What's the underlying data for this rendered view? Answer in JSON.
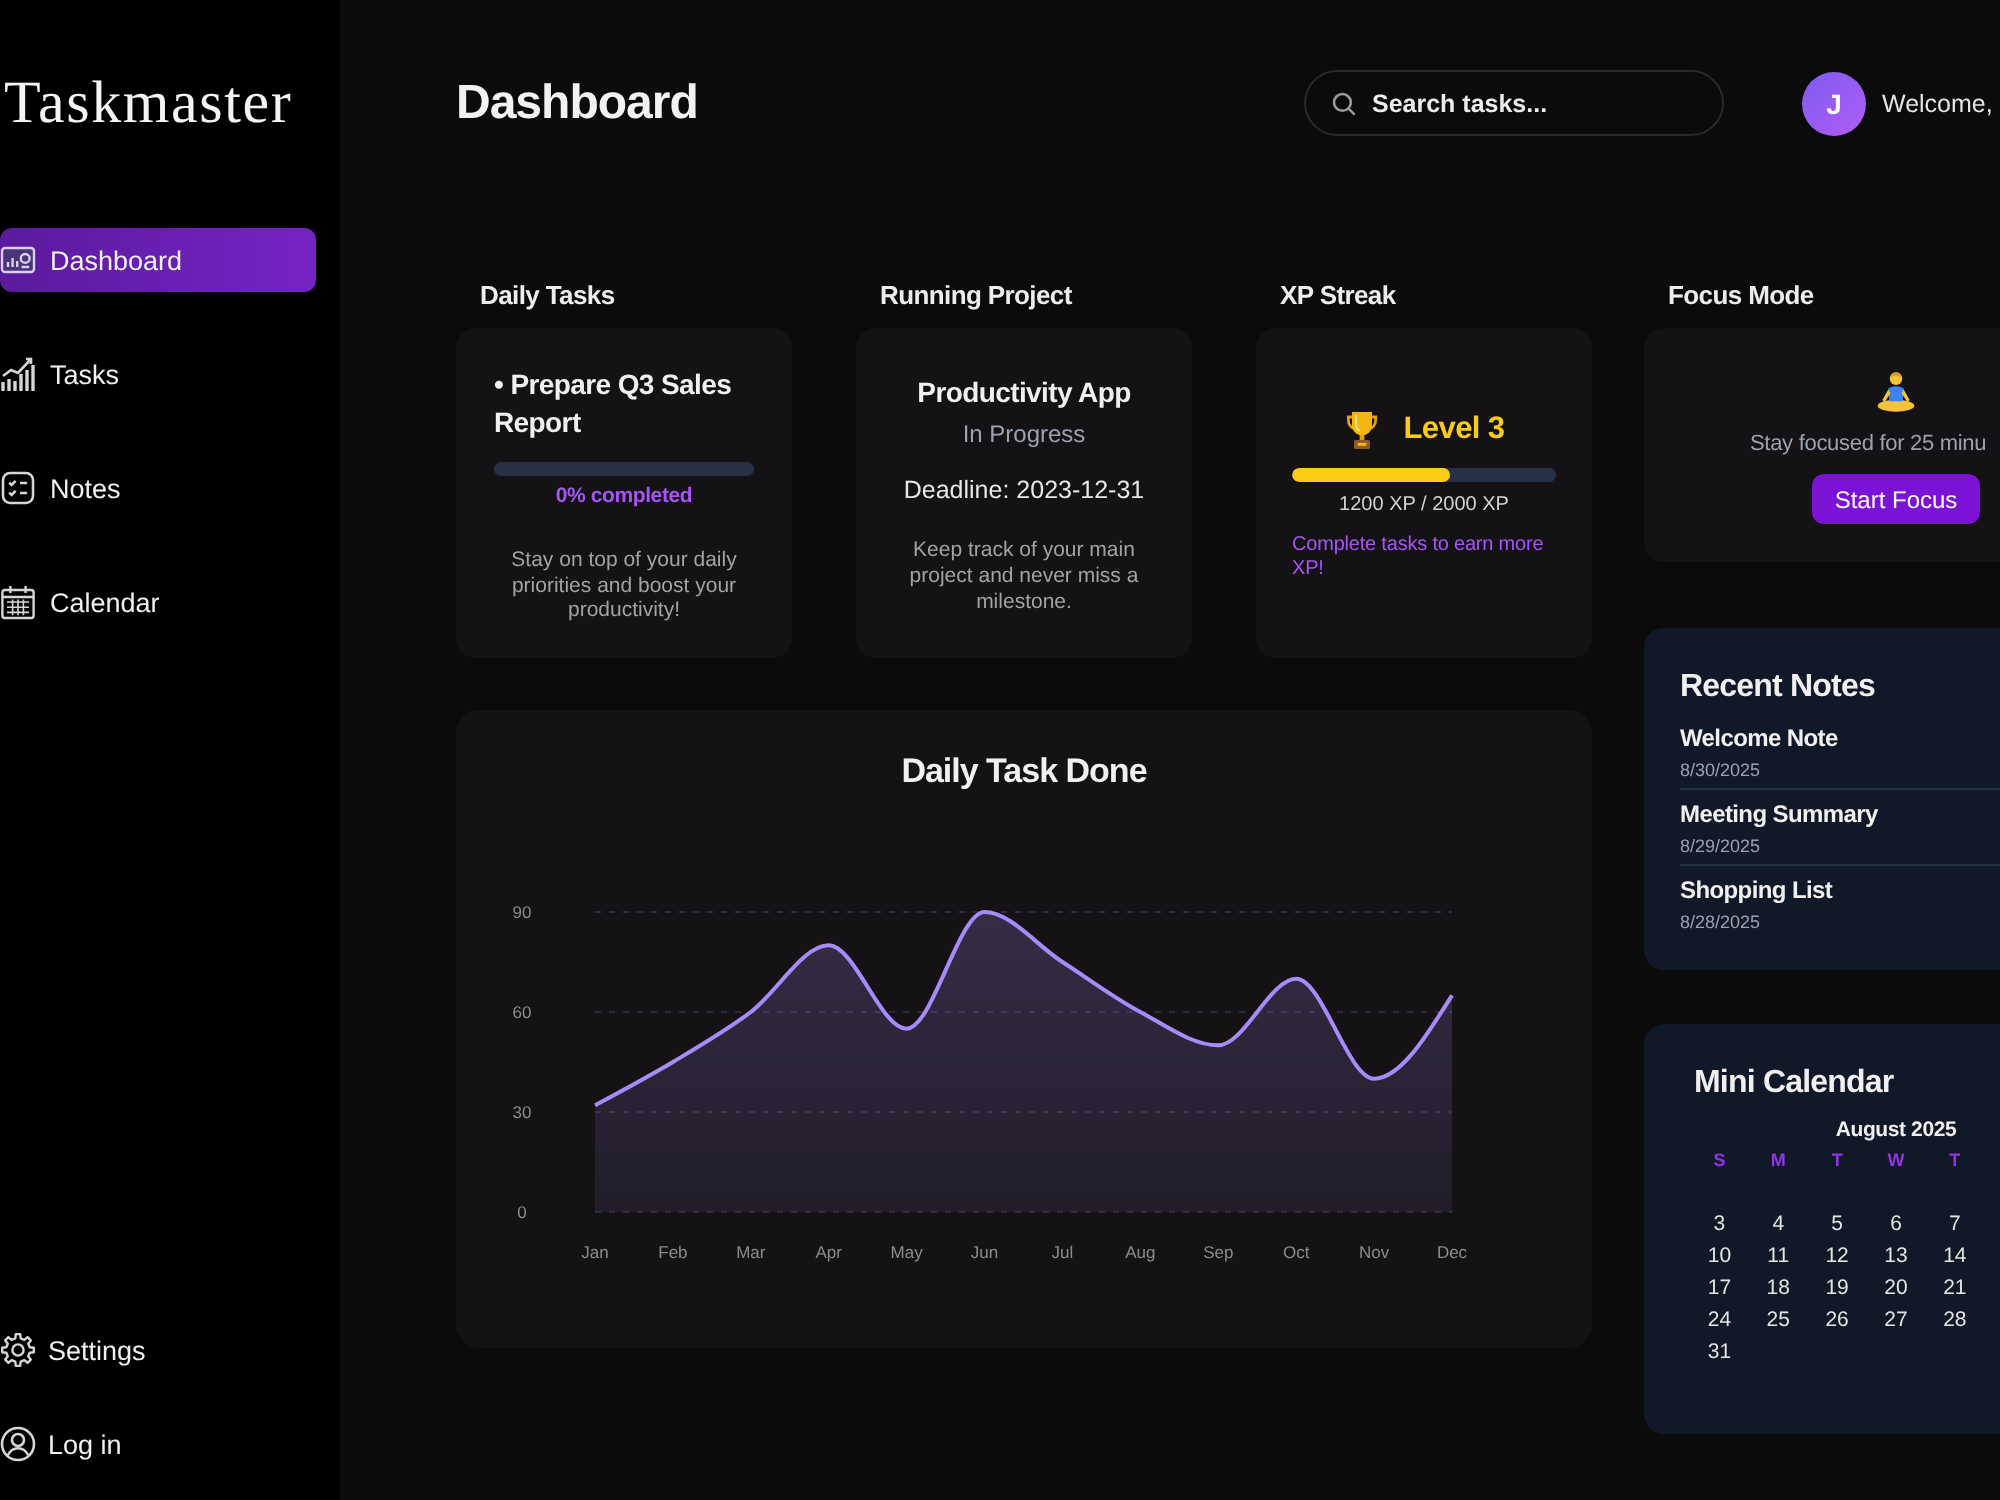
{
  "sidebar": {
    "logo": "Taskmaster",
    "nav": [
      {
        "label": "Dashboard",
        "selected": true
      },
      {
        "label": "Tasks",
        "selected": false
      },
      {
        "label": "Notes",
        "selected": false
      },
      {
        "label": "Calendar",
        "selected": false
      }
    ],
    "footer": [
      {
        "label": "Settings"
      },
      {
        "label": "Log in"
      }
    ]
  },
  "header": {
    "title": "Dashboard",
    "search": {
      "placeholder": "Search tasks..."
    },
    "user": {
      "initial": "J",
      "greeting": "Welcome,"
    }
  },
  "daily_tasks": {
    "label": "Daily Tasks",
    "tasks": [
      {
        "title": "• Prepare Q3 Sales Report"
      }
    ],
    "progress": {
      "text": "0% completed"
    },
    "description": "Stay on top of your daily priorities and boost your productivity!"
  },
  "running_project": {
    "label": "Running Project",
    "name": "Productivity App",
    "status": "In Progress",
    "deadline": "Deadline: 2023-12-31",
    "description": "Keep track of your main project and never miss a milestone."
  },
  "xp_streak": {
    "label": "XP Streak",
    "level_text": "Level 3",
    "xp_bar": {
      "level": 0.6
    },
    "xp": "1200 XP / 2000 XP",
    "hint": "Complete tasks to earn more XP!"
  },
  "task_chart": {
    "chart_data": {
      "type": "area",
      "title": "Daily Task Done",
      "categories": [
        "Jan",
        "Feb",
        "Mar",
        "Apr",
        "May",
        "Jun",
        "Jul",
        "Aug",
        "Sep",
        "Oct",
        "Nov",
        "Dec"
      ],
      "series": [
        {
          "color": "#a78bfa",
          "values": [
            32,
            45,
            60,
            80,
            55,
            90,
            75,
            60,
            50,
            70,
            40,
            65
          ]
        }
      ],
      "ylim": [
        0,
        90
      ],
      "yticks": [
        0,
        30,
        60,
        90
      ]
    }
  },
  "focus_mode": {
    "label": "Focus Mode",
    "message": "Stay focused for 25 minu",
    "button": "Start Focus"
  },
  "recent_notes": {
    "title": "Recent Notes",
    "notes": [
      {
        "title": "Welcome Note",
        "date": "8/30/2025"
      },
      {
        "title": "Meeting Summary",
        "date": "8/29/2025"
      },
      {
        "title": "Shopping List",
        "date": "8/28/2025"
      }
    ]
  },
  "mini_calendar": {
    "title": "Mini Calendar",
    "month": "August 2025",
    "weekdays": [
      "S",
      "M",
      "T",
      "W",
      "T"
    ],
    "weeks": [
      [
        "3",
        "4",
        "5",
        "6",
        "7"
      ],
      [
        "10",
        "11",
        "12",
        "13",
        "14"
      ],
      [
        "17",
        "18",
        "19",
        "20",
        "21"
      ],
      [
        "24",
        "25",
        "26",
        "27",
        "28"
      ],
      [
        "31"
      ]
    ]
  }
}
